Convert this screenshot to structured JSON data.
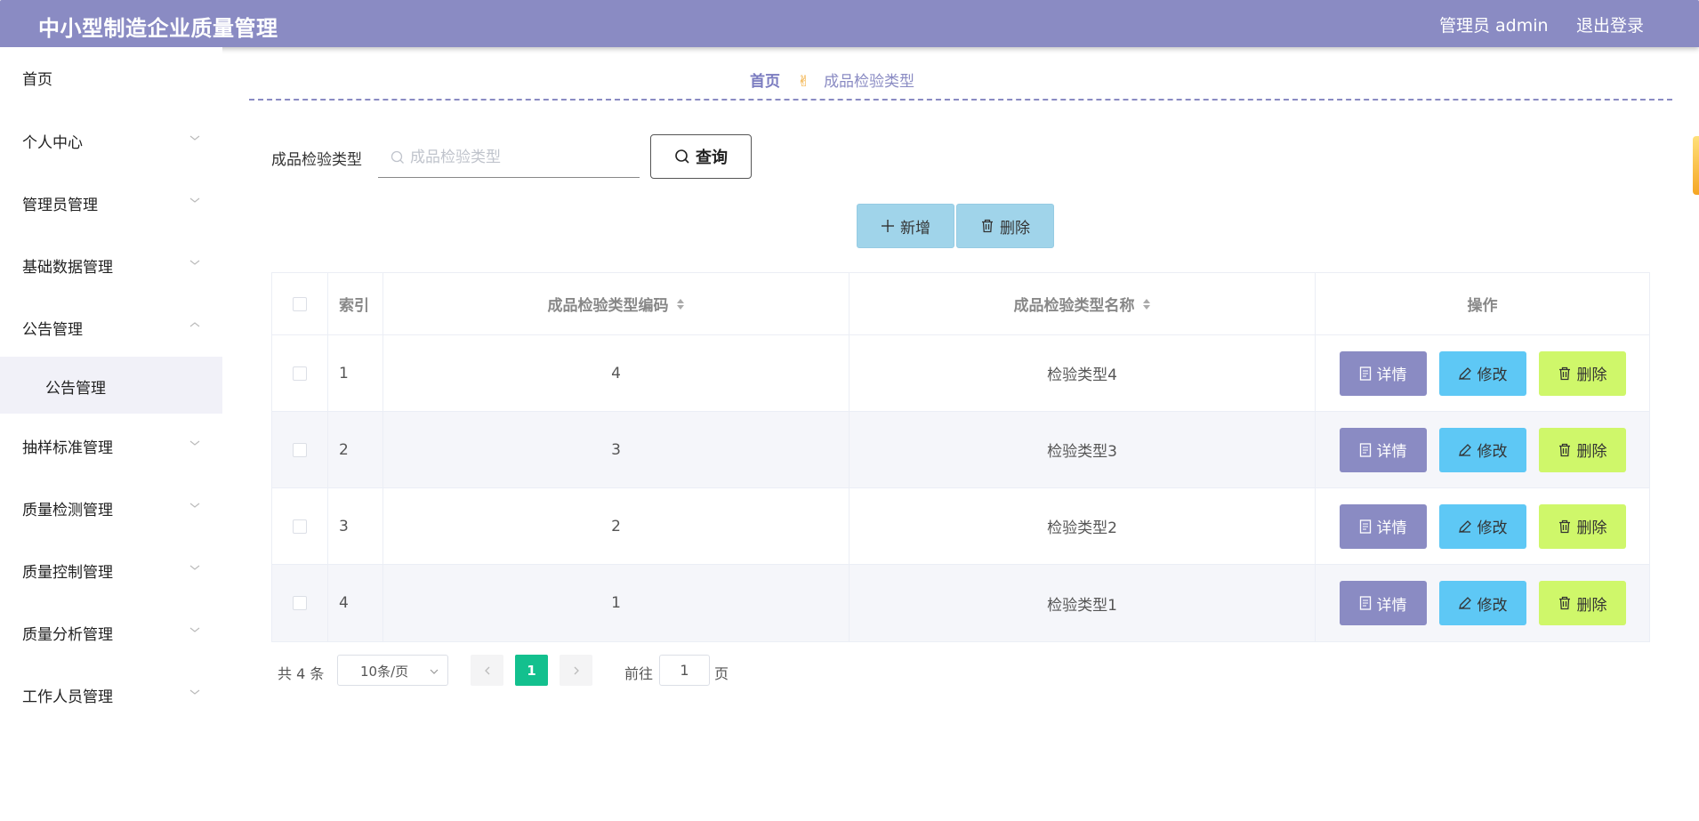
{
  "header": {
    "title": "中小型制造企业质量管理",
    "user": "管理员 admin",
    "logout": "退出登录"
  },
  "sidebar": {
    "items": [
      {
        "label": "首页"
      },
      {
        "label": "个人中心"
      },
      {
        "label": "管理员管理"
      },
      {
        "label": "基础数据管理"
      },
      {
        "label": "公告管理"
      },
      {
        "label": "公告管理"
      },
      {
        "label": "抽样标准管理"
      },
      {
        "label": "质量检测管理"
      },
      {
        "label": "质量控制管理"
      },
      {
        "label": "质量分析管理"
      },
      {
        "label": "工作人员管理"
      }
    ]
  },
  "breadcrumb": {
    "home": "首页",
    "separator": "✌",
    "current": "成品检验类型"
  },
  "search": {
    "label": "成品检验类型",
    "placeholder": "成品检验类型",
    "value": "",
    "button": "查询"
  },
  "actions": {
    "add": "新增",
    "delete": "删除"
  },
  "table": {
    "headers": {
      "index": "索引",
      "code": "成品检验类型编码",
      "name": "成品检验类型名称",
      "ops": "操作"
    },
    "rows": [
      {
        "index": "1",
        "code": "4",
        "name": "检验类型4"
      },
      {
        "index": "2",
        "code": "3",
        "name": "检验类型3"
      },
      {
        "index": "3",
        "code": "2",
        "name": "检验类型2"
      },
      {
        "index": "4",
        "code": "1",
        "name": "检验类型1"
      }
    ],
    "op_labels": {
      "detail": "详情",
      "edit": "修改",
      "delete": "删除"
    }
  },
  "pagination": {
    "total": "共 4 条",
    "page_size": "10条/页",
    "current_page": "1",
    "goto_label": "前往",
    "goto_value": "1",
    "page_unit": "页"
  },
  "colors": {
    "header": "#8a8bc3",
    "detail_button": "#8a8bc3",
    "edit_button": "#5ec8f5",
    "delete_button": "#cff76a",
    "active_page": "#13c08e",
    "action_button": "#a0d4ea"
  }
}
